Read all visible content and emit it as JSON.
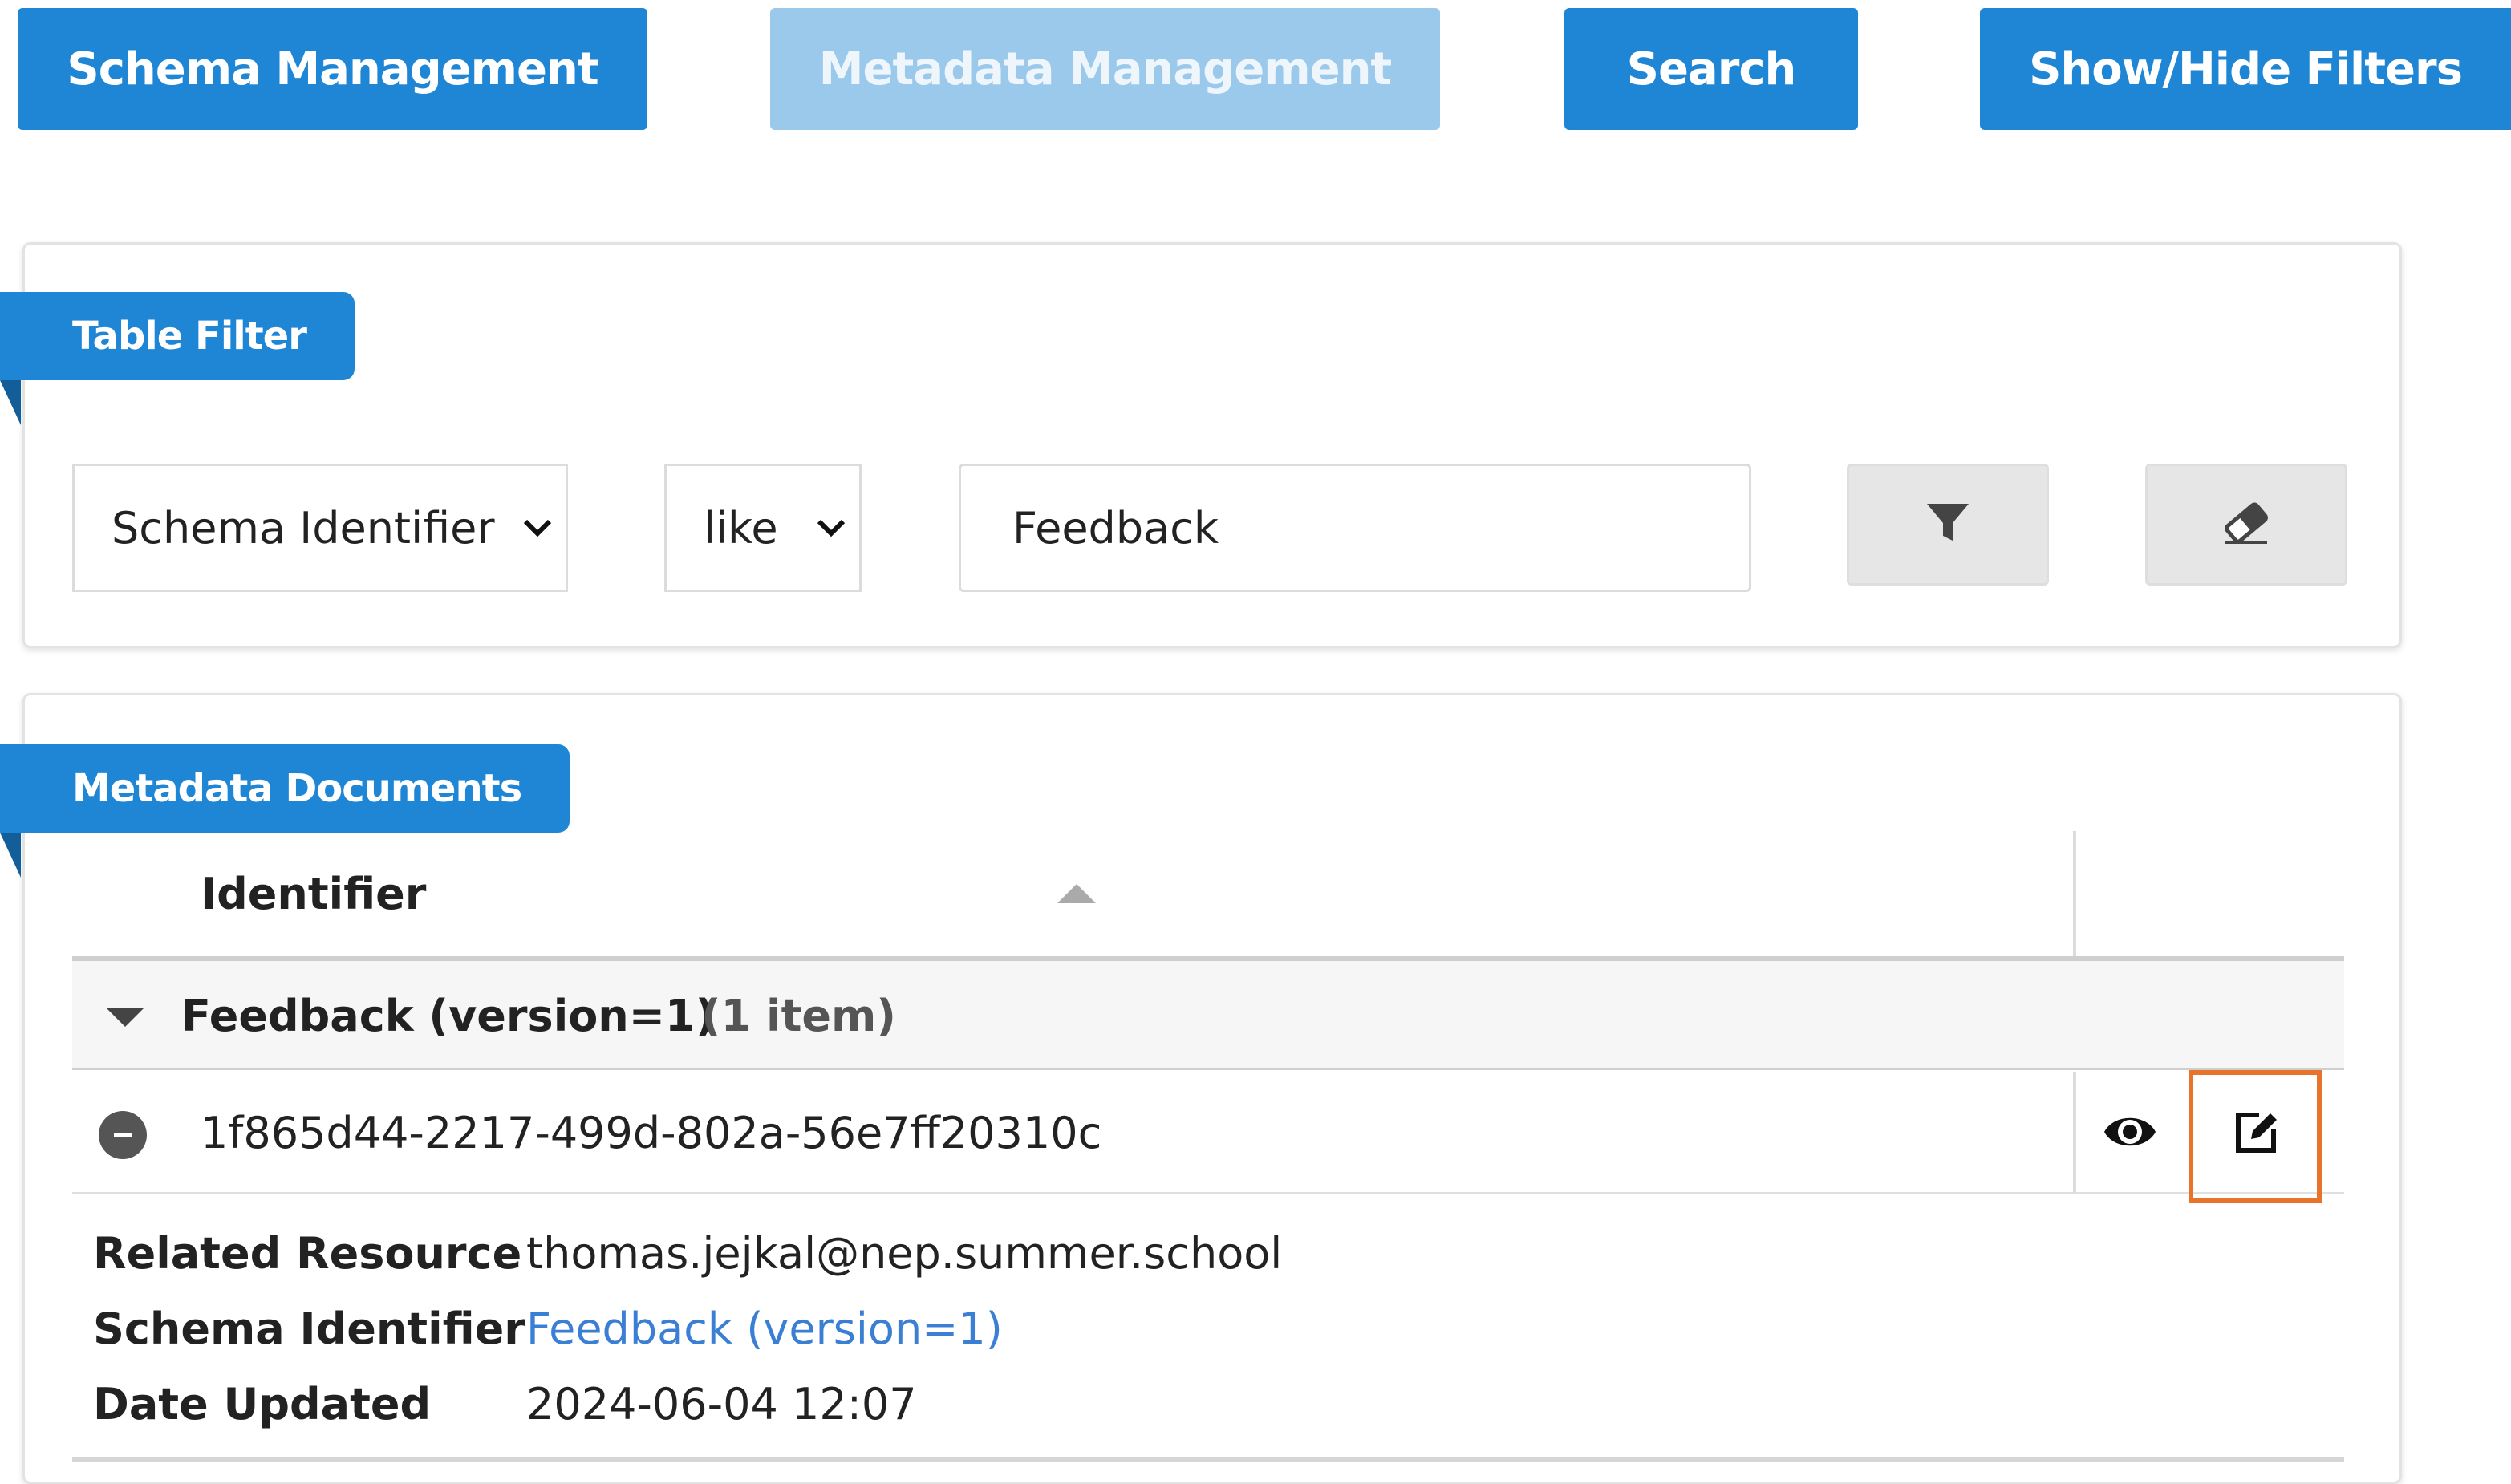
{
  "nav": {
    "schema_management": "Schema Management",
    "metadata_management": "Metadata Management",
    "search": "Search",
    "show_hide_filters": "Show/Hide Filters"
  },
  "table_filter": {
    "title": "Table Filter",
    "field_select": "Schema Identifier",
    "operator_select": "like",
    "value": "Feedback",
    "apply_icon": "filter-icon",
    "clear_icon": "eraser-icon"
  },
  "documents": {
    "title": "Metadata Documents",
    "column_identifier": "Identifier",
    "group_label": "Feedback (version=1)",
    "group_count": "(1 item)",
    "row": {
      "identifier": "1f865d44-2217-499d-802a-56e7ff20310c",
      "view_icon": "eye-icon",
      "edit_icon": "edit-icon"
    },
    "details": {
      "related_resource_label": "Related Resource",
      "related_resource_value": "thomas.jejkal@nep.summer.school",
      "schema_identifier_label": "Schema Identifier",
      "schema_identifier_value": "Feedback (version=1)",
      "date_updated_label": "Date Updated",
      "date_updated_value": "2024-06-04 12:07"
    }
  },
  "colors": {
    "primary": "#1f86d6",
    "primary_disabled": "#9bc9ec",
    "highlight": "#e8732c",
    "link": "#3b7fd4"
  }
}
